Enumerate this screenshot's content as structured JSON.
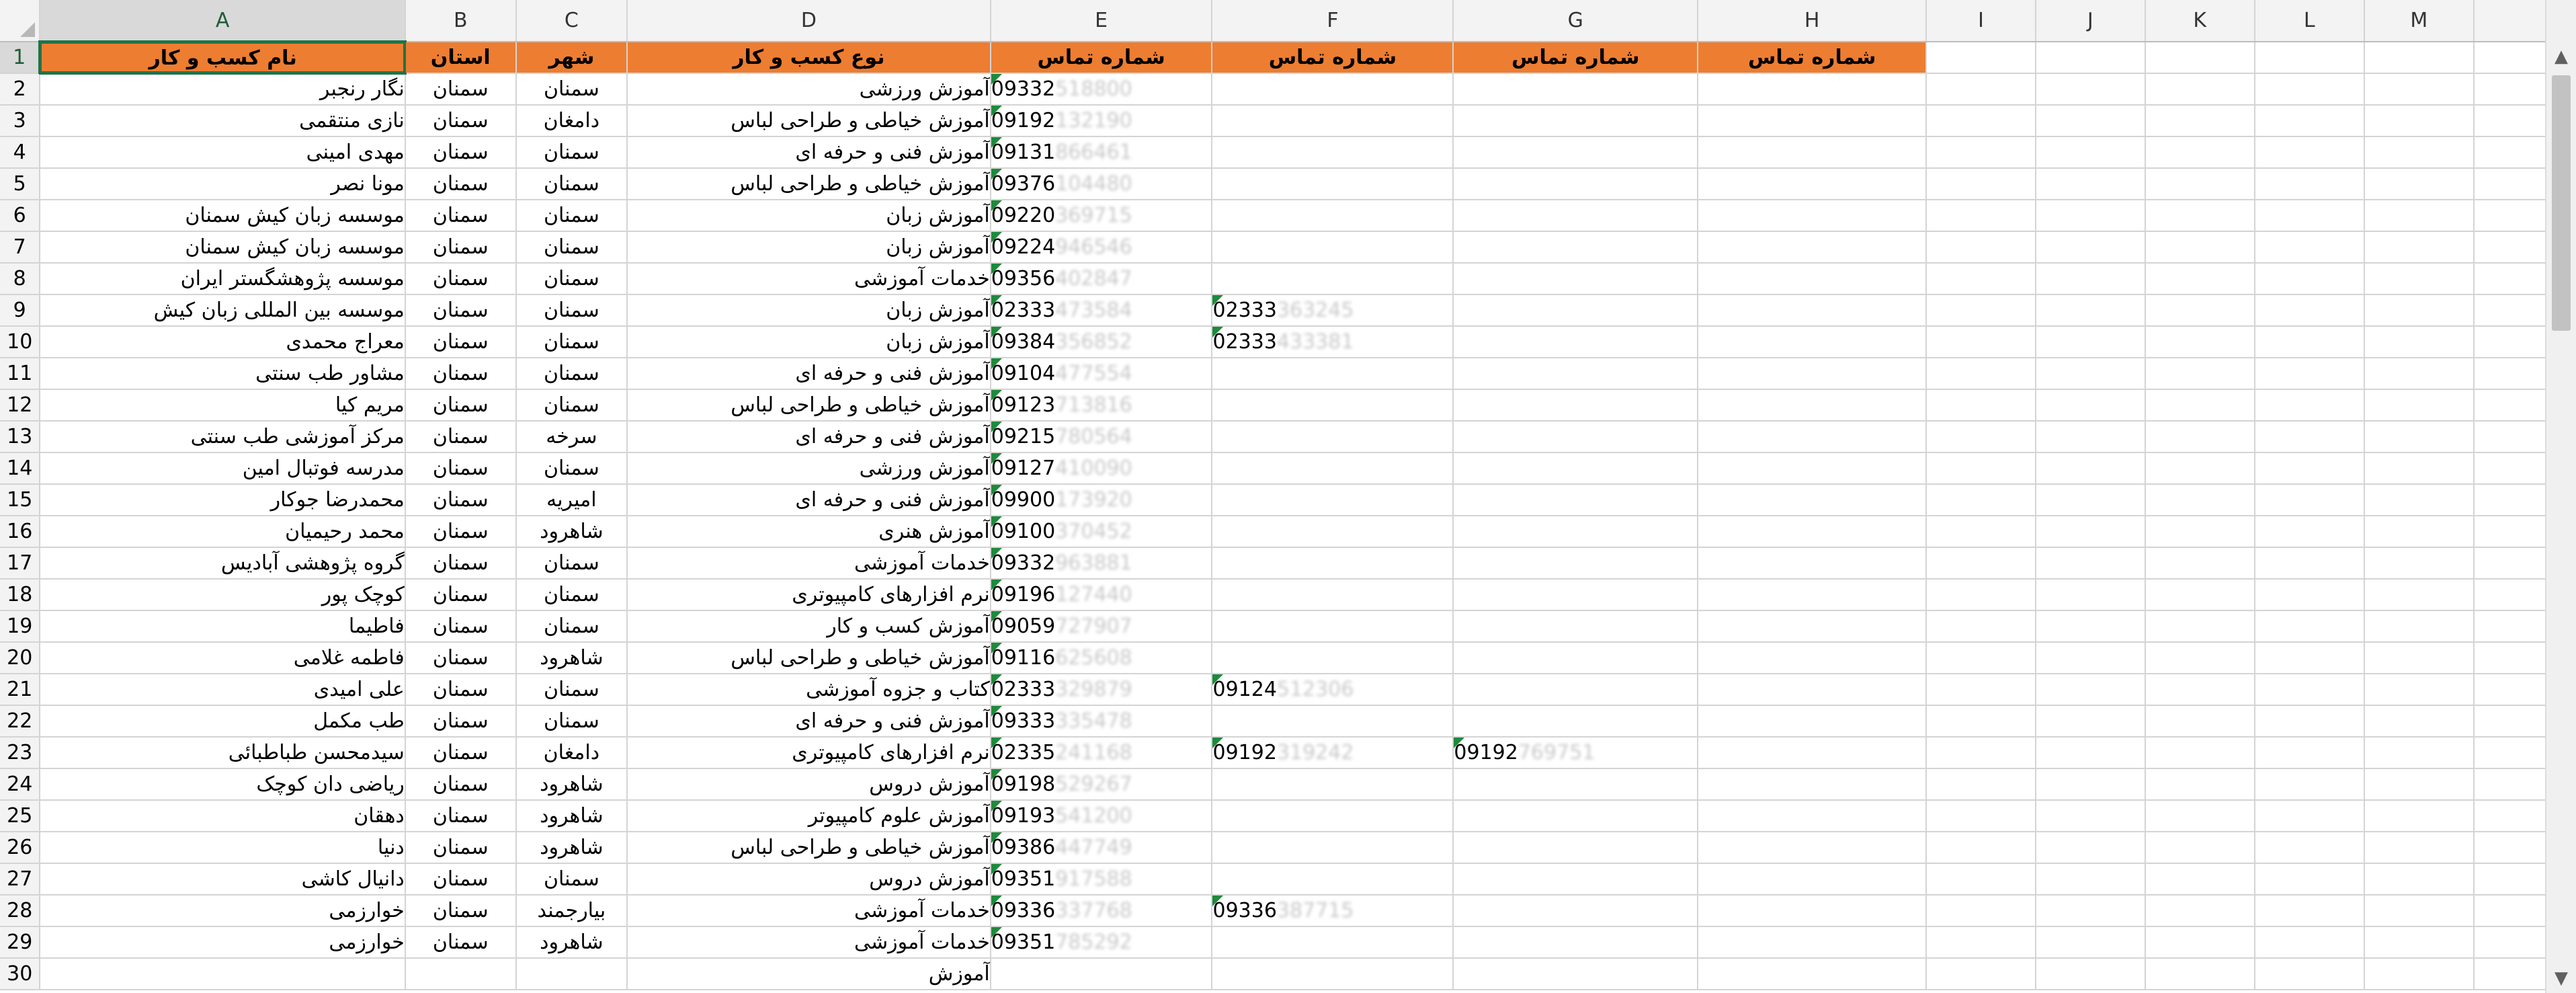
{
  "columns": [
    "A",
    "B",
    "C",
    "D",
    "E",
    "F",
    "G",
    "H",
    "I",
    "J",
    "K",
    "L",
    "M"
  ],
  "selected_column": "A",
  "selected_row": "1",
  "header_row": {
    "row_number": "1",
    "business_name": "نام کسب و کار",
    "province": "استان",
    "city": "شهر",
    "business_type": "نوع کسب و کار",
    "phone_e": "شماره تماس",
    "phone_f": "شماره تماس",
    "phone_g": "شماره تماس",
    "phone_h": "شماره تماس"
  },
  "rows": [
    {
      "n": "2",
      "name": "نگار رنجبر",
      "province": "سمنان",
      "city": "سمنان",
      "type": "آموزش ورزشی",
      "e_vis": "09332",
      "e_blur": "518800",
      "f_vis": "",
      "f_blur": "",
      "g_vis": "",
      "g_blur": ""
    },
    {
      "n": "3",
      "name": "نازی منتقمی",
      "province": "سمنان",
      "city": "دامغان",
      "type": "آموزش خیاطی و طراحی لباس",
      "e_vis": "09192",
      "e_blur": "132190",
      "f_vis": "",
      "f_blur": "",
      "g_vis": "",
      "g_blur": ""
    },
    {
      "n": "4",
      "name": "مهدی امینی",
      "province": "سمنان",
      "city": "سمنان",
      "type": "آموزش فنی و حرفه ای",
      "e_vis": "09131",
      "e_blur": "866461",
      "f_vis": "",
      "f_blur": "",
      "g_vis": "",
      "g_blur": ""
    },
    {
      "n": "5",
      "name": "مونا نصر",
      "province": "سمنان",
      "city": "سمنان",
      "type": "آموزش خیاطی و طراحی لباس",
      "e_vis": "09376",
      "e_blur": "104480",
      "f_vis": "",
      "f_blur": "",
      "g_vis": "",
      "g_blur": ""
    },
    {
      "n": "6",
      "name": "موسسه زبان کیش سمنان",
      "province": "سمنان",
      "city": "سمنان",
      "type": "آموزش زبان",
      "e_vis": "09220",
      "e_blur": "369715",
      "f_vis": "",
      "f_blur": "",
      "g_vis": "",
      "g_blur": ""
    },
    {
      "n": "7",
      "name": "موسسه زبان کیش سمنان",
      "province": "سمنان",
      "city": "سمنان",
      "type": "آموزش زبان",
      "e_vis": "09224",
      "e_blur": "946546",
      "f_vis": "",
      "f_blur": "",
      "g_vis": "",
      "g_blur": ""
    },
    {
      "n": "8",
      "name": "موسسه پژوهشگستر ایران",
      "province": "سمنان",
      "city": "سمنان",
      "type": "خدمات آموزشی",
      "e_vis": "09356",
      "e_blur": "402847",
      "f_vis": "",
      "f_blur": "",
      "g_vis": "",
      "g_blur": ""
    },
    {
      "n": "9",
      "name": "موسسه  بین المللی زبان کیش",
      "province": "سمنان",
      "city": "سمنان",
      "type": "آموزش زبان",
      "e_vis": "02333",
      "e_blur": "473584",
      "f_vis": "02333",
      "f_blur": "363245",
      "g_vis": "",
      "g_blur": ""
    },
    {
      "n": "10",
      "name": "معراج محمدی",
      "province": "سمنان",
      "city": "سمنان",
      "type": "آموزش زبان",
      "e_vis": "09384",
      "e_blur": "356852",
      "f_vis": "02333",
      "f_blur": "433381",
      "g_vis": "",
      "g_blur": ""
    },
    {
      "n": "11",
      "name": "مشاور طب سنتی",
      "province": "سمنان",
      "city": "سمنان",
      "type": "آموزش فنی و حرفه ای",
      "e_vis": "09104",
      "e_blur": "477554",
      "f_vis": "",
      "f_blur": "",
      "g_vis": "",
      "g_blur": ""
    },
    {
      "n": "12",
      "name": "مریم کیا",
      "province": "سمنان",
      "city": "سمنان",
      "type": "آموزش خیاطی و طراحی لباس",
      "e_vis": "09123",
      "e_blur": "713816",
      "f_vis": "",
      "f_blur": "",
      "g_vis": "",
      "g_blur": ""
    },
    {
      "n": "13",
      "name": "مرکز آموزشی طب سنتی",
      "province": "سمنان",
      "city": "سرخه",
      "type": "آموزش فنی و حرفه ای",
      "e_vis": "09215",
      "e_blur": "780564",
      "f_vis": "",
      "f_blur": "",
      "g_vis": "",
      "g_blur": ""
    },
    {
      "n": "14",
      "name": "مدرسه فوتبال امین",
      "province": "سمنان",
      "city": "سمنان",
      "type": "آموزش ورزشی",
      "e_vis": "09127",
      "e_blur": "410090",
      "f_vis": "",
      "f_blur": "",
      "g_vis": "",
      "g_blur": ""
    },
    {
      "n": "15",
      "name": "محمدرضا جوکار",
      "province": "سمنان",
      "city": "امیریه",
      "type": "آموزش فنی و حرفه ای",
      "e_vis": "09900",
      "e_blur": "173920",
      "f_vis": "",
      "f_blur": "",
      "g_vis": "",
      "g_blur": ""
    },
    {
      "n": "16",
      "name": "محمد رحیمیان",
      "province": "سمنان",
      "city": "شاهرود",
      "type": "آموزش هنری",
      "e_vis": "09100",
      "e_blur": "370452",
      "f_vis": "",
      "f_blur": "",
      "g_vis": "",
      "g_blur": ""
    },
    {
      "n": "17",
      "name": "گروه پژوهشی آبادیس",
      "province": "سمنان",
      "city": "سمنان",
      "type": "خدمات آموزشی",
      "e_vis": "09332",
      "e_blur": "963881",
      "f_vis": "",
      "f_blur": "",
      "g_vis": "",
      "g_blur": ""
    },
    {
      "n": "18",
      "name": "کوچک پور",
      "province": "سمنان",
      "city": "سمنان",
      "type": "نرم افزارهای کامپیوتری",
      "e_vis": "09196",
      "e_blur": "127440",
      "f_vis": "",
      "f_blur": "",
      "g_vis": "",
      "g_blur": ""
    },
    {
      "n": "19",
      "name": "فاطیما",
      "province": "سمنان",
      "city": "سمنان",
      "type": "آموزش کسب و کار",
      "e_vis": "09059",
      "e_blur": "727907",
      "f_vis": "",
      "f_blur": "",
      "g_vis": "",
      "g_blur": ""
    },
    {
      "n": "20",
      "name": "فاطمه غلامی",
      "province": "سمنان",
      "city": "شاهرود",
      "type": "آموزش خیاطی و طراحی لباس",
      "e_vis": "09116",
      "e_blur": "625608",
      "f_vis": "",
      "f_blur": "",
      "g_vis": "",
      "g_blur": ""
    },
    {
      "n": "21",
      "name": "علی امیدی",
      "province": "سمنان",
      "city": "سمنان",
      "type": "کتاب و جزوه آموزشی",
      "e_vis": "02333",
      "e_blur": "329879",
      "f_vis": "09124",
      "f_blur": "512306",
      "g_vis": "",
      "g_blur": ""
    },
    {
      "n": "22",
      "name": "طب مکمل",
      "province": "سمنان",
      "city": "سمنان",
      "type": "آموزش فنی و حرفه ای",
      "e_vis": "09333",
      "e_blur": "335478",
      "f_vis": "",
      "f_blur": "",
      "g_vis": "",
      "g_blur": ""
    },
    {
      "n": "23",
      "name": "سیدمحسن طباطبائی",
      "province": "سمنان",
      "city": "دامغان",
      "type": "نرم افزارهای کامپیوتری",
      "e_vis": "02335",
      "e_blur": "241168",
      "f_vis": "09192",
      "f_blur": "319242",
      "g_vis": "09192",
      "g_blur": "769751"
    },
    {
      "n": "24",
      "name": "ریاضی دان کوچک",
      "province": "سمنان",
      "city": "شاهرود",
      "type": "آموزش دروس",
      "e_vis": "09198",
      "e_blur": "529267",
      "f_vis": "",
      "f_blur": "",
      "g_vis": "",
      "g_blur": ""
    },
    {
      "n": "25",
      "name": "دهقان",
      "province": "سمنان",
      "city": "شاهرود",
      "type": "آموزش علوم کامپیوتر",
      "e_vis": "09193",
      "e_blur": "541200",
      "f_vis": "",
      "f_blur": "",
      "g_vis": "",
      "g_blur": ""
    },
    {
      "n": "26",
      "name": "دنیا",
      "province": "سمنان",
      "city": "شاهرود",
      "type": "آموزش خیاطی و طراحی لباس",
      "e_vis": "09386",
      "e_blur": "447749",
      "f_vis": "",
      "f_blur": "",
      "g_vis": "",
      "g_blur": ""
    },
    {
      "n": "27",
      "name": "دانیال کاشی",
      "province": "سمنان",
      "city": "سمنان",
      "type": "آموزش دروس",
      "e_vis": "09351",
      "e_blur": "917588",
      "f_vis": "",
      "f_blur": "",
      "g_vis": "",
      "g_blur": ""
    },
    {
      "n": "28",
      "name": "خوارزمی",
      "province": "سمنان",
      "city": "بیارجمند",
      "type": "خدمات آموزشی",
      "e_vis": "09336",
      "e_blur": "337768",
      "f_vis": "09336",
      "f_blur": "387715",
      "g_vis": "",
      "g_blur": ""
    },
    {
      "n": "29",
      "name": "خوارزمی",
      "province": "سمنان",
      "city": "شاهرود",
      "type": "خدمات آموزشی",
      "e_vis": "09351",
      "e_blur": "785292",
      "f_vis": "",
      "f_blur": "",
      "g_vis": "",
      "g_blur": ""
    },
    {
      "n": "30",
      "name": "",
      "province": "",
      "city": "",
      "type": "آموزش",
      "e_vis": "",
      "e_blur": "",
      "f_vis": "",
      "f_blur": "",
      "g_vis": "",
      "g_blur": ""
    }
  ],
  "scrollbar": {
    "up_icon": "▲",
    "down_icon": "▼"
  }
}
